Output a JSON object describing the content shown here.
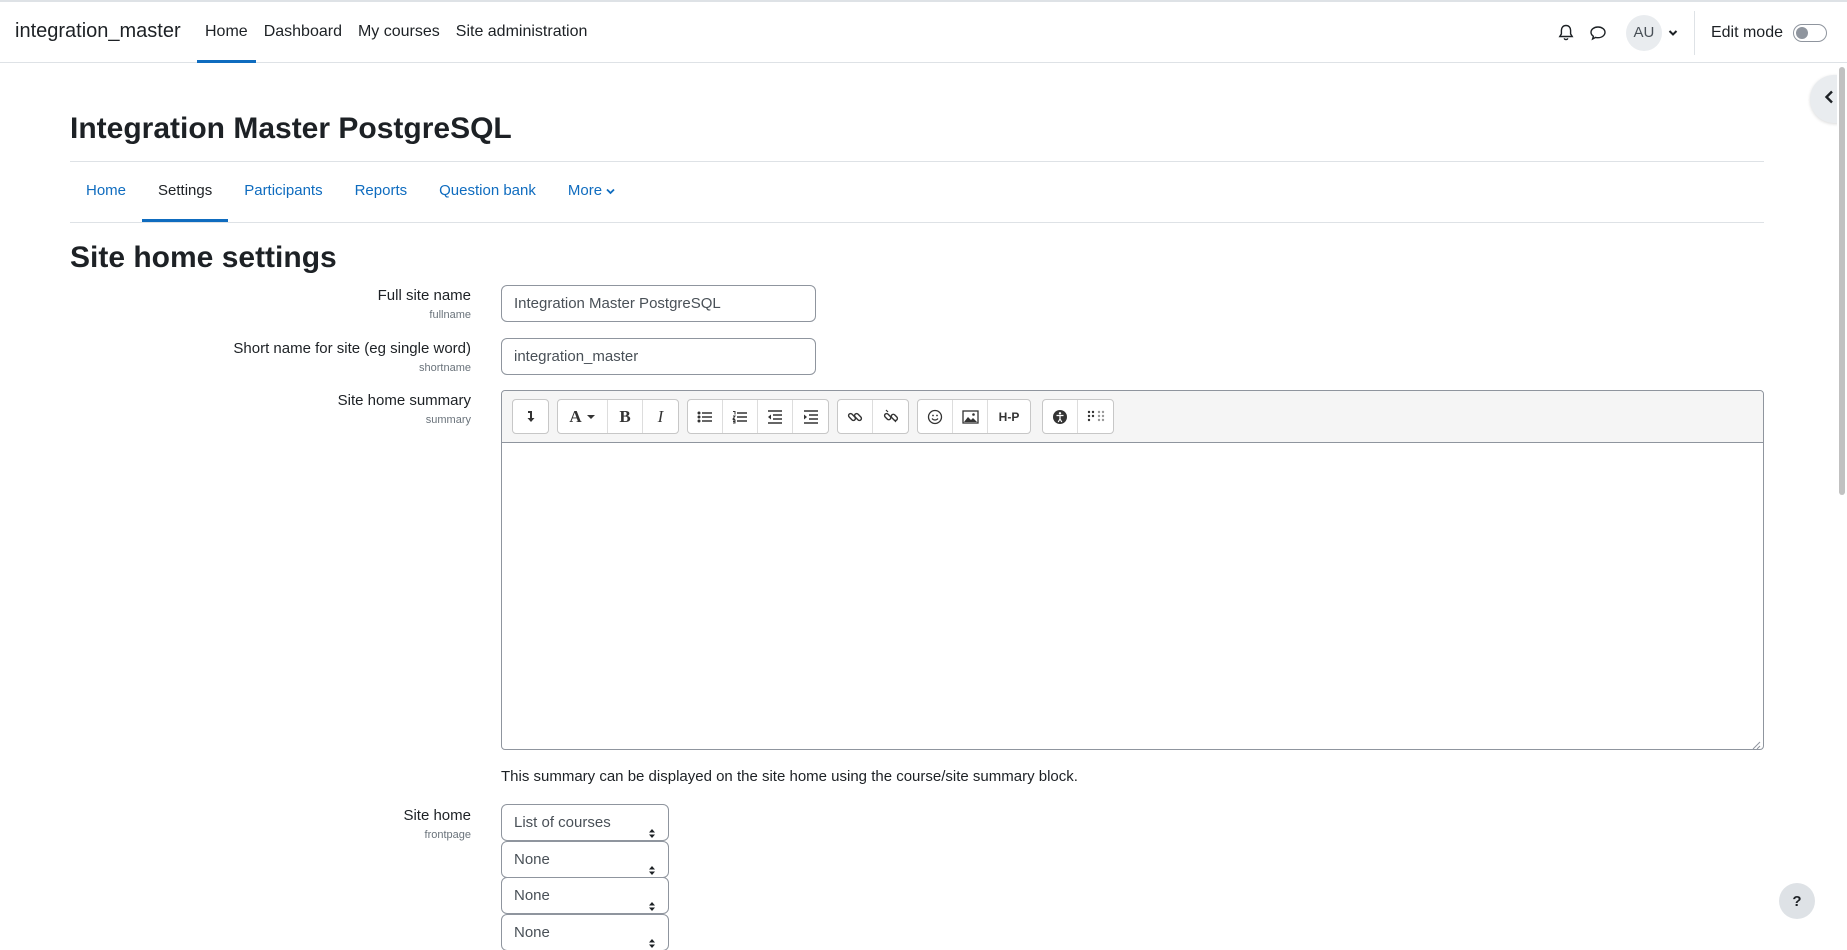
{
  "navbar": {
    "brand": "integration_master",
    "items": [
      {
        "label": "Home"
      },
      {
        "label": "Dashboard"
      },
      {
        "label": "My courses"
      },
      {
        "label": "Site administration"
      }
    ],
    "avatar_initials": "AU",
    "edit_mode_label": "Edit mode",
    "edit_mode_on": false
  },
  "page": {
    "title": "Integration Master PostgreSQL",
    "tabs": [
      {
        "label": "Home"
      },
      {
        "label": "Settings"
      },
      {
        "label": "Participants"
      },
      {
        "label": "Reports"
      },
      {
        "label": "Question bank"
      },
      {
        "label": "More"
      }
    ],
    "active_tab": "Settings",
    "section_title": "Site home settings"
  },
  "form": {
    "fullname": {
      "label": "Full site name",
      "sublabel": "fullname",
      "value": "Integration Master PostgreSQL"
    },
    "shortname": {
      "label": "Short name for site (eg single word)",
      "sublabel": "shortname",
      "value": "integration_master"
    },
    "summary": {
      "label": "Site home summary",
      "sublabel": "summary",
      "help": "This summary can be displayed on the site home using the course/site summary block."
    },
    "frontpage": {
      "label": "Site home",
      "sublabel": "frontpage",
      "selects": [
        "List of courses",
        "None",
        "None",
        "None"
      ]
    }
  },
  "editor_toolbar": [
    [
      "collapse-icon"
    ],
    [
      "font-style-icon",
      "bold-icon",
      "italic-icon"
    ],
    [
      "unordered-list-icon",
      "ordered-list-icon",
      "outdent-icon",
      "indent-icon"
    ],
    [
      "link-icon",
      "unlink-icon"
    ],
    [
      "emoji-icon",
      "image-icon",
      "h5p-icon"
    ],
    [
      "accessibility-checker-icon",
      "screenreader-helper-icon"
    ]
  ],
  "help_button": "?",
  "colors": {
    "accent": "#0f6cbf",
    "text": "#1d2125",
    "border": "#8f959e"
  }
}
